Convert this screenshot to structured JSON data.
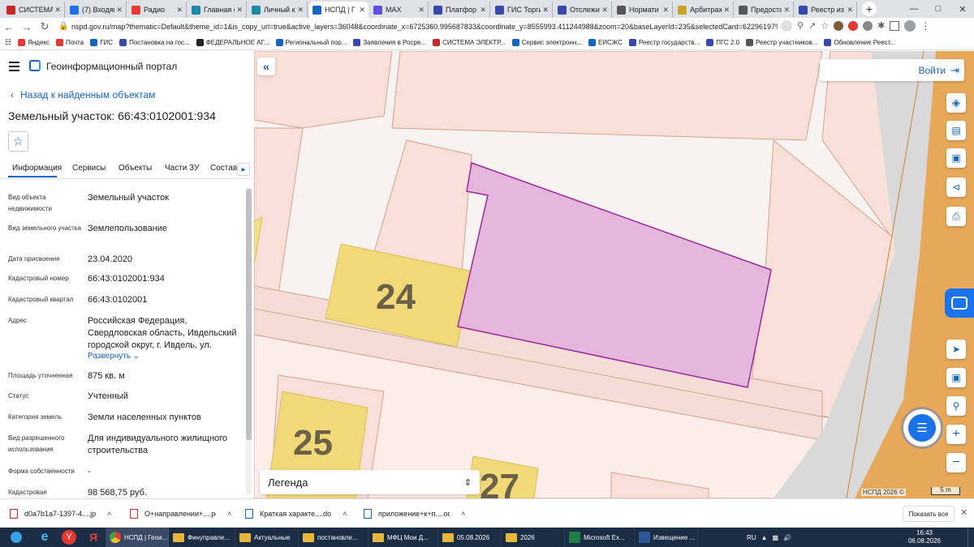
{
  "browser": {
    "tabs": [
      {
        "label": "СИСТЕМА",
        "color": "#c62828"
      },
      {
        "label": "(7) Входящ",
        "color": "#1a73e8"
      },
      {
        "label": "Радио",
        "color": "#e53935"
      },
      {
        "label": "Главная с",
        "color": "#1e88a8"
      },
      {
        "label": "Личный к",
        "color": "#1e88a8"
      },
      {
        "label": "НСПД | Г",
        "color": "#1565c0"
      },
      {
        "label": "MAX",
        "color": "#5c4ee5"
      },
      {
        "label": "Платфор",
        "color": "#3949ab"
      },
      {
        "label": "ГИС Торги",
        "color": "#3949ab"
      },
      {
        "label": "Отслежив",
        "color": "#3949ab"
      },
      {
        "label": "Нормати",
        "color": "#555555"
      },
      {
        "label": "Арбитраж",
        "color": "#c9a227"
      },
      {
        "label": "Предоста",
        "color": "#555555"
      },
      {
        "label": "Реестр из",
        "color": "#3949ab"
      }
    ],
    "url": "nspd.gov.ru/map?thematic=Default&theme_id=1&is_copy_url=true&active_layers=36048&coordinate_x=6725360.995687833&coordinate_y=8555993.411244988&zoom=20&baseLayerId=235&selectedCard=62296197%2C36368...",
    "bookmarks": [
      "Яндекс",
      "Почта",
      "ГИС",
      "Постановка на гос...",
      "ФЕДЕРАЛЬНОЕ АГ...",
      "Региональный пор...",
      "Заявления в Росре...",
      "СИСТЕМА ЭЛЕКТР...",
      "Сервис электронн...",
      "ЕИСЖС",
      "Реестр государств...",
      "ПГС 2.0",
      "Реестр участников...",
      "Обновление Реест..."
    ]
  },
  "portal": {
    "title": "Геоинформационный портал",
    "back_label": "Назад к найденным объектам",
    "object_title": "Земельный участок: 66:43:0102001:934",
    "tabs": [
      "Информация",
      "Сервисы",
      "Объекты",
      "Части ЗУ",
      "Состав"
    ],
    "attributes": [
      {
        "label": "Вид объекта недвижимости",
        "value": "Земельный участок"
      },
      {
        "label": "Вид земельного участка",
        "value": "Землепользование"
      },
      {
        "label": "Дата присвоения",
        "value": "23.04.2020"
      },
      {
        "label": "Кадастровый номер",
        "value": "66:43:0102001:934"
      },
      {
        "label": "Кадастровый квартал",
        "value": "66:43:0102001"
      },
      {
        "label": "Адрес",
        "value": "Российская Федерация, Свердловская область, Ивдельский городской округ, г. Ивдель, ул."
      },
      {
        "label": "Площадь уточненная",
        "value": "875 кв. м"
      },
      {
        "label": "Статус",
        "value": "Учтенный"
      },
      {
        "label": "Категория земель",
        "value": "Земли населенных пунктов"
      },
      {
        "label": "Вид разрешенного использования",
        "value": "Для индивидуального жилищного строительства"
      },
      {
        "label": "Форма собственности",
        "value": "-"
      },
      {
        "label": "Кадастровая",
        "value": "98 568,75 руб."
      }
    ],
    "expand_label": "Развернуть"
  },
  "map": {
    "login_label": "Войти",
    "legend_label": "Легенда",
    "copyright": "НСПД 2026 ©",
    "scale_label": "5 m",
    "building_numbers": [
      "24",
      "25",
      "27"
    ],
    "parcel_color": "#e4b6db",
    "parcel_stroke": "#9c2a9c",
    "accent": "#1a73e8"
  },
  "downloads": {
    "items": [
      {
        "name": "d0a7b1a7-1397-4....jpg",
        "color": "#c62828"
      },
      {
        "name": "О+направлении+....pdf",
        "color": "#d32f2f"
      },
      {
        "name": "Краткая характе....doc",
        "color": "#1565c0"
      },
      {
        "name": "приложение+к+п....odt",
        "color": "#1565c0"
      }
    ],
    "show_all": "Показать все"
  },
  "taskbar": {
    "apps": [
      "НСПД | Геои...",
      "Финуправле...",
      "Актуальные",
      "постановле...",
      "МФЦ Мои Д...",
      "05.08.2026",
      "2026",
      "Microsoft Ex...",
      "Извещение ..."
    ],
    "lang": "RU",
    "time": "16:43",
    "date": "06.08.2026"
  }
}
